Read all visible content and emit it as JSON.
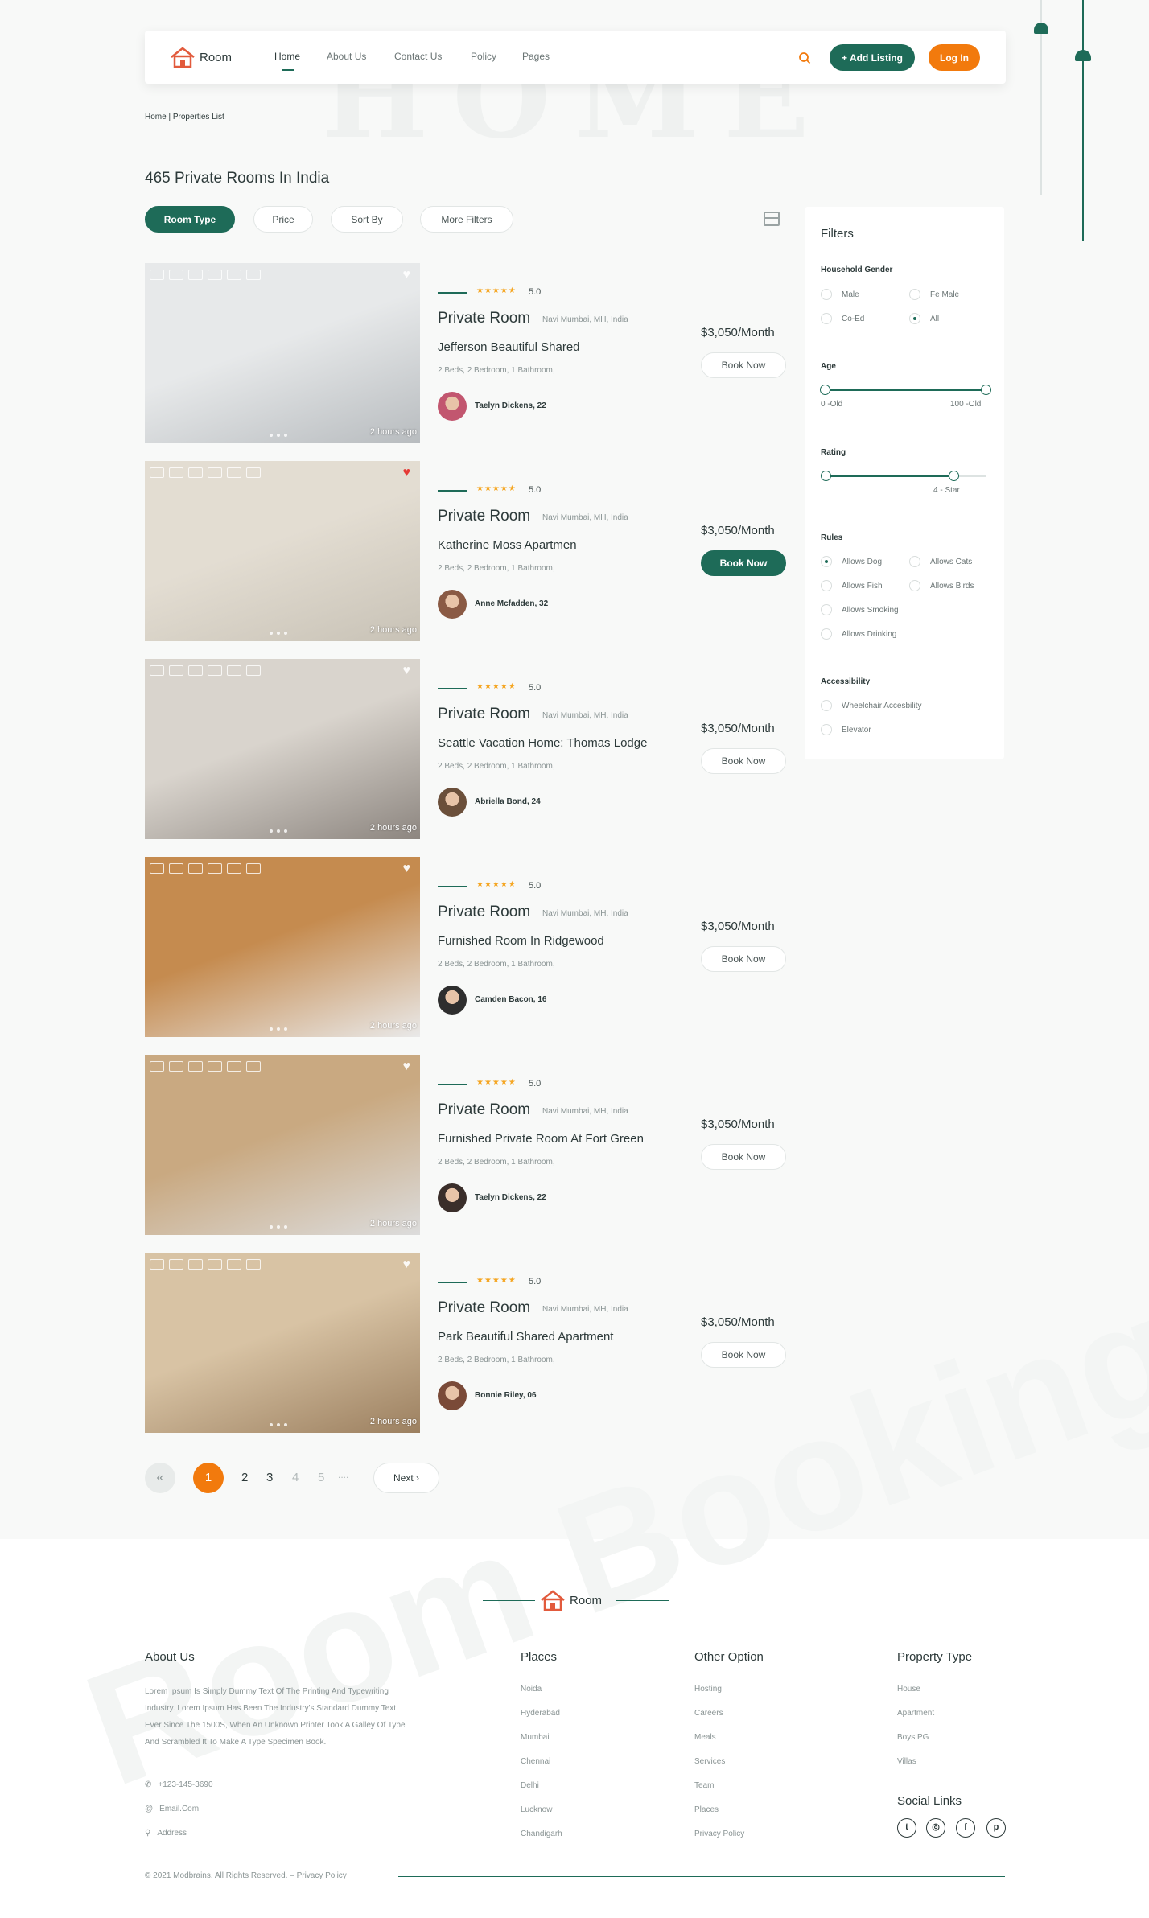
{
  "nav": {
    "brand": "Room",
    "links": [
      "Home",
      "About Us",
      "Contact Us",
      "Policy",
      "Pages"
    ],
    "add_listing": "+ Add Listing",
    "login": "Log In",
    "search_icon": "search-icon"
  },
  "breadcrumb": "Home | Properties List",
  "page_title": "465 Private Rooms In India",
  "filter_chips": [
    "Room Type",
    "Price",
    "Sort By",
    "More Filters"
  ],
  "listings": [
    {
      "stars": "★★★★★",
      "rating": "5.0",
      "title": "Private Room",
      "location": "Navi Mumbai, MH, India",
      "name": "Jefferson Beautiful Shared",
      "details": "2 Beds, 2 Bedroom, 1 Bathroom,",
      "host": "Taelyn Dickens, 22",
      "price": "$3,050/Month",
      "book": "Book Now",
      "ago": "2 hours ago",
      "favorite": false,
      "photo_colors": [
        "#b8bcbf",
        "#e7e9ea"
      ]
    },
    {
      "stars": "★★★★★",
      "rating": "5.0",
      "title": "Private Room",
      "location": "Navi Mumbai, MH, India",
      "name": "Katherine Moss Apartmen",
      "details": "2 Beds, 2 Bedroom, 1 Bathroom,",
      "host": "Anne Mcfadden, 32",
      "price": "$3,050/Month",
      "book": "Book Now",
      "ago": "2 hours ago",
      "favorite": true,
      "photo_colors": [
        "#c8c2b6",
        "#e3ddd2"
      ]
    },
    {
      "stars": "★★★★★",
      "rating": "5.0",
      "title": "Private Room",
      "location": "Navi Mumbai, MH, India",
      "name": "Seattle Vacation Home: Thomas Lodge",
      "details": "2 Beds, 2 Bedroom, 1 Bathroom,",
      "host": "Abriella Bond, 24",
      "price": "$3,050/Month",
      "book": "Book Now",
      "ago": "2 hours ago",
      "favorite": false,
      "photo_colors": [
        "#8d8680",
        "#d9d4cd"
      ]
    },
    {
      "stars": "★★★★★",
      "rating": "5.0",
      "title": "Private Room",
      "location": "Navi Mumbai, MH, India",
      "name": "Furnished Room In Ridgewood",
      "details": "2 Beds, 2 Bedroom, 1 Bathroom,",
      "host": "Camden Bacon, 16",
      "price": "$3,050/Month",
      "book": "Book Now",
      "ago": "2 hours ago",
      "favorite": false,
      "photo_colors": [
        "#e9e9e9",
        "#c58b4f"
      ]
    },
    {
      "stars": "★★★★★",
      "rating": "5.0",
      "title": "Private Room",
      "location": "Navi Mumbai, MH, India",
      "name": "Furnished Private Room At Fort Green",
      "details": "2 Beds, 2 Bedroom, 1 Bathroom,",
      "host": "Taelyn Dickens, 22",
      "price": "$3,050/Month",
      "book": "Book Now",
      "ago": "2 hours ago",
      "favorite": false,
      "photo_colors": [
        "#dcdcdc",
        "#c9a981"
      ]
    },
    {
      "stars": "★★★★★",
      "rating": "5.0",
      "title": "Private Room",
      "location": "Navi Mumbai, MH, India",
      "name": "Park Beautiful Shared Apartment",
      "details": "2 Beds, 2 Bedroom, 1 Bathroom,",
      "host": "Bonnie Riley, 06",
      "price": "$3,050/Month",
      "book": "Book Now",
      "ago": "2 hours ago",
      "favorite": false,
      "photo_colors": [
        "#9c8060",
        "#d8c3a4"
      ]
    }
  ],
  "filters": {
    "title": "Filters",
    "household_gender": {
      "label": "Household Gender",
      "options": [
        "Male",
        "Fe Male",
        "Co-Ed",
        "All"
      ],
      "selected": "All"
    },
    "age": {
      "label": "Age",
      "min_label": "0 -Old",
      "max_label": "100 -Old",
      "low": 0,
      "high": 100
    },
    "rating": {
      "label": "Rating",
      "value_label": "4 - Star",
      "value": 4,
      "max": 5
    },
    "rules": {
      "label": "Rules",
      "options": [
        "Allows Dog",
        "Allows Cats",
        "Allows Fish",
        "Allows Birds",
        "Allows Smoking",
        "Allows Drinking"
      ],
      "selected": "Allows Dog"
    },
    "accessibility": {
      "label": "Accessibility",
      "options": [
        "Wheelchair Accesbility",
        "Elevator"
      ]
    }
  },
  "pagination": {
    "prev": "«",
    "pages": [
      "1",
      "2",
      "3",
      "4",
      "5",
      "...."
    ],
    "current": "1",
    "next": "Next ›"
  },
  "footer": {
    "brand": "Room",
    "watermark": "Room Booking",
    "about_title": "About Us",
    "about_text": "Lorem Ipsum Is Simply Dummy Text Of The Printing And Typewriting Industry. Lorem Ipsum Has Been The Industry's Standard Dummy Text Ever Since The 1500S, When An Unknown Printer Took A Galley Of Type And Scrambled It To Make A Type Specimen Book.",
    "phone": "+123-145-3690",
    "email": "Email.Com",
    "address": "Address",
    "places_title": "Places",
    "places": [
      "Noida",
      "Hyderabad",
      "Mumbai",
      "Chennai",
      "Delhi",
      "Lucknow",
      "Chandigarh"
    ],
    "other_title": "Other Option",
    "other": [
      "Hosting",
      "Careers",
      "Meals",
      "Services",
      "Team",
      "Places",
      "Privacy Policy"
    ],
    "property_title": "Property Type",
    "property": [
      "House",
      "Apartment",
      "Boys PG",
      "Villas"
    ],
    "social_title": "Social Links",
    "social_glyphs": [
      "t",
      "◎",
      "f",
      "p"
    ],
    "copyright": "© 2021 Modbrains. All Rights Reserved. – Privacy Policy"
  },
  "colors": {
    "accent": "#1e6b58",
    "orange": "#f27a0d",
    "star": "#f5a623"
  }
}
